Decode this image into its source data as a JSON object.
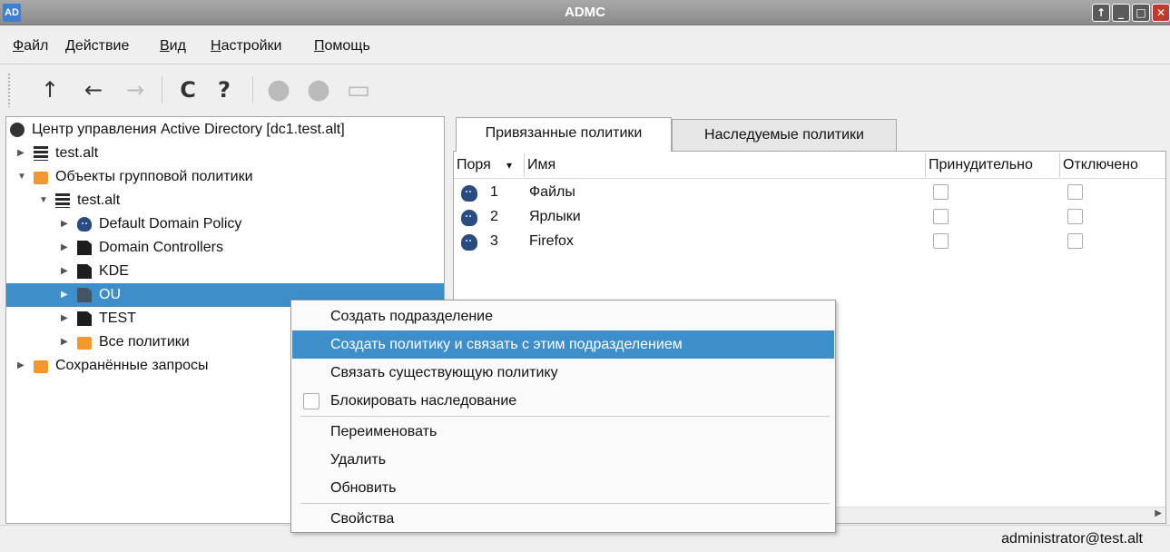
{
  "window": {
    "title": "ADMC",
    "app_icon_text": "AD",
    "buttons": [
      "↑",
      "_",
      "□",
      "✕"
    ]
  },
  "menubar": [
    {
      "mnemonic": "Ф",
      "rest": "айл"
    },
    {
      "mnemonic": "",
      "rest": "Действие"
    },
    {
      "mnemonic": "В",
      "rest": "ид"
    },
    {
      "mnemonic": "Н",
      "rest": "астройки"
    },
    {
      "mnemonic": "П",
      "rest": "омощь"
    }
  ],
  "toolbar": {
    "icons": [
      "up-arrow-icon",
      "back-arrow-icon",
      "forward-arrow-icon",
      "refresh-icon",
      "help-icon",
      "user-icon",
      "user-icon",
      "container-icon"
    ],
    "glyphs": {
      "up": "↑",
      "back": "←",
      "forward": "→",
      "refresh": "C",
      "help": "?",
      "user": "●",
      "container": "▭"
    }
  },
  "tree": [
    {
      "label": "Центр управления Active Directory [dc1.test.alt]",
      "icon": "globe-icon",
      "level": 0,
      "arrow": ""
    },
    {
      "label": "test.alt",
      "icon": "server-icon",
      "level": 0,
      "arrow": "▶"
    },
    {
      "label": "Объекты групповой политики",
      "icon": "folder-icon",
      "level": 0,
      "arrow": "▼"
    },
    {
      "label": "test.alt",
      "icon": "server-icon",
      "level": 1,
      "arrow": "▼"
    },
    {
      "label": "Default Domain Policy",
      "icon": "gpo-icon",
      "level": 2,
      "arrow": "▶"
    },
    {
      "label": "Domain Controllers",
      "icon": "ou-icon",
      "level": 2,
      "arrow": "▶"
    },
    {
      "label": "KDE",
      "icon": "ou-icon",
      "level": 2,
      "arrow": "▶"
    },
    {
      "label": "OU",
      "icon": "ou-icon",
      "level": 2,
      "arrow": "▶",
      "selected": true
    },
    {
      "label": "TEST",
      "icon": "ou-icon",
      "level": 2,
      "arrow": "▶"
    },
    {
      "label": "Все политики",
      "icon": "folder-icon",
      "level": 2,
      "arrow": "▶"
    },
    {
      "label": "Сохранённые запросы",
      "icon": "folder-icon",
      "level": 0,
      "arrow": "▶"
    }
  ],
  "tabs": [
    {
      "label": "Привязанные политики",
      "active": true
    },
    {
      "label": "Наследуемые политики",
      "active": false
    }
  ],
  "table": {
    "headers": {
      "order": "Поря",
      "sort_indicator": "▾",
      "name": "Имя",
      "enforced": "Принудительно",
      "disabled": "Отключено"
    },
    "rows": [
      {
        "order": "1",
        "name": "Файлы",
        "enforced": false,
        "disabled": false
      },
      {
        "order": "2",
        "name": "Ярлыки",
        "enforced": false,
        "disabled": false
      },
      {
        "order": "3",
        "name": "Firefox",
        "enforced": false,
        "disabled": false
      }
    ],
    "scroll_arrow": "▶"
  },
  "context_menu": [
    {
      "label": "Создать подразделение"
    },
    {
      "label": "Создать политику и связать с этим подразделением",
      "highlighted": true
    },
    {
      "label": "Связать существующую политику"
    },
    {
      "label": "Блокировать наследование",
      "checkbox": true,
      "checked": false
    },
    {
      "separator": true
    },
    {
      "label": "Переименовать"
    },
    {
      "label": "Удалить"
    },
    {
      "label": "Обновить"
    },
    {
      "separator": true
    },
    {
      "label": "Свойства"
    }
  ],
  "status": {
    "user": "administrator@test.alt"
  },
  "colors": {
    "selection": "#3d8ec9",
    "folder": "#f2982f",
    "titlebar": "#9a9a9a"
  }
}
